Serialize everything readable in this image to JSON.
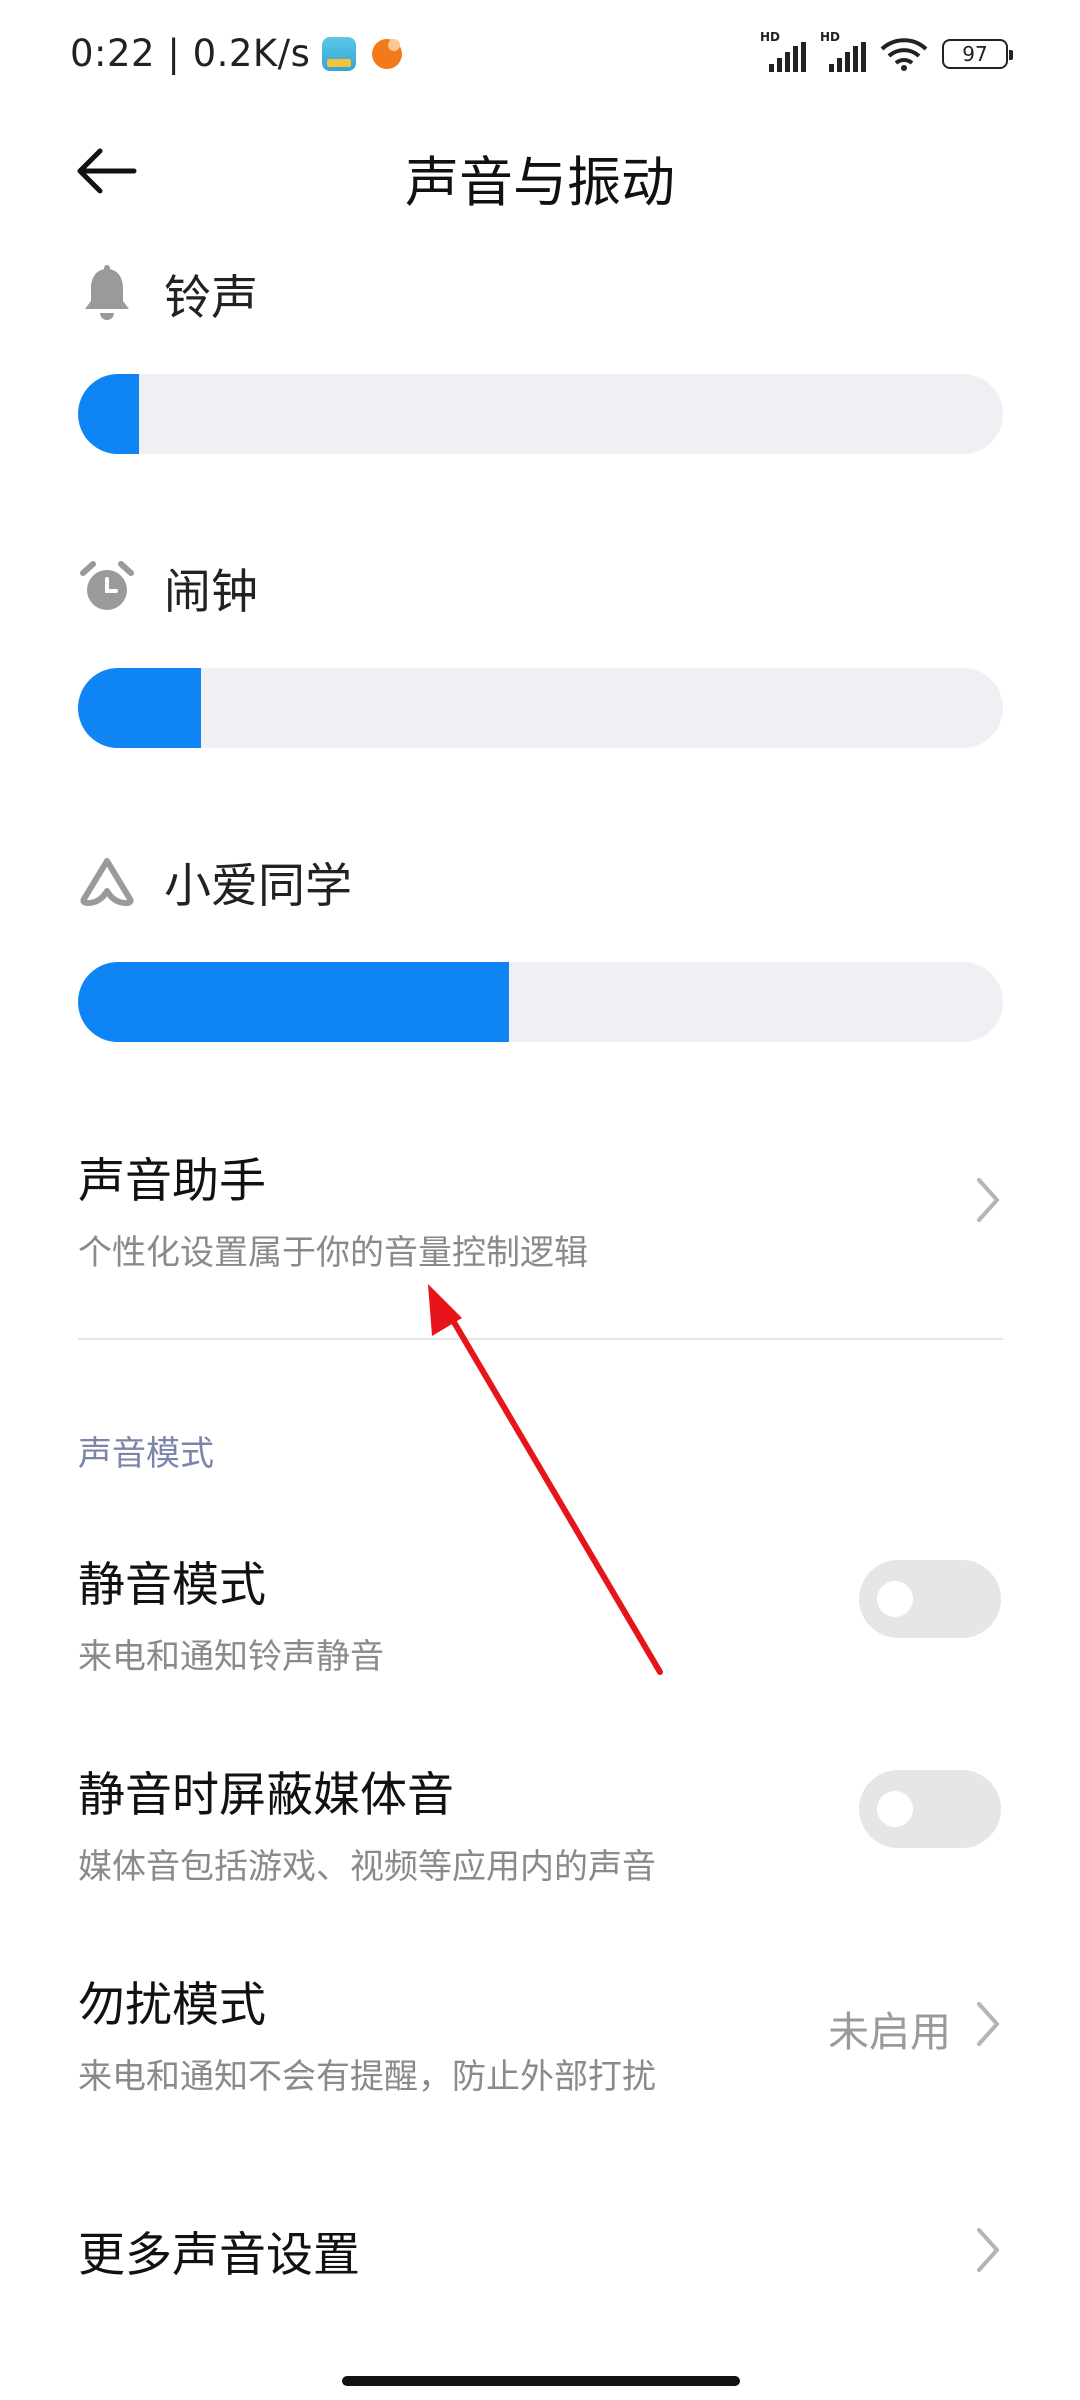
{
  "status_bar": {
    "time": "0:22 | 0.2K/s",
    "battery": "97",
    "hd_label": "HD"
  },
  "header": {
    "title": "声音与振动"
  },
  "volume": {
    "ringtone": {
      "label": "铃声",
      "icon": "bell-icon",
      "level_fraction": 0.066
    },
    "alarm": {
      "label": "闹钟",
      "icon": "alarm-clock-icon",
      "level_fraction": 0.133
    },
    "xiaoai": {
      "label": "小爱同学",
      "icon": "xiaoai-icon",
      "level_fraction": 0.466
    }
  },
  "sound_assistant": {
    "title": "声音助手",
    "subtitle": "个性化设置属于你的音量控制逻辑"
  },
  "sound_mode": {
    "section_title": "声音模式",
    "mute_mode": {
      "title": "静音模式",
      "subtitle": "来电和通知铃声静音",
      "enabled": false
    },
    "mute_media": {
      "title": "静音时屏蔽媒体音",
      "subtitle": "媒体音包括游戏、视频等应用内的声音",
      "enabled": false
    },
    "dnd": {
      "title": "勿扰模式",
      "subtitle": "来电和通知不会有提醒，防止外部打扰",
      "value": "未启用"
    },
    "more": {
      "title": "更多声音设置"
    }
  },
  "colors": {
    "accent": "#0f84f5",
    "track": "#eef0f4",
    "annotation": "#e8141b"
  }
}
